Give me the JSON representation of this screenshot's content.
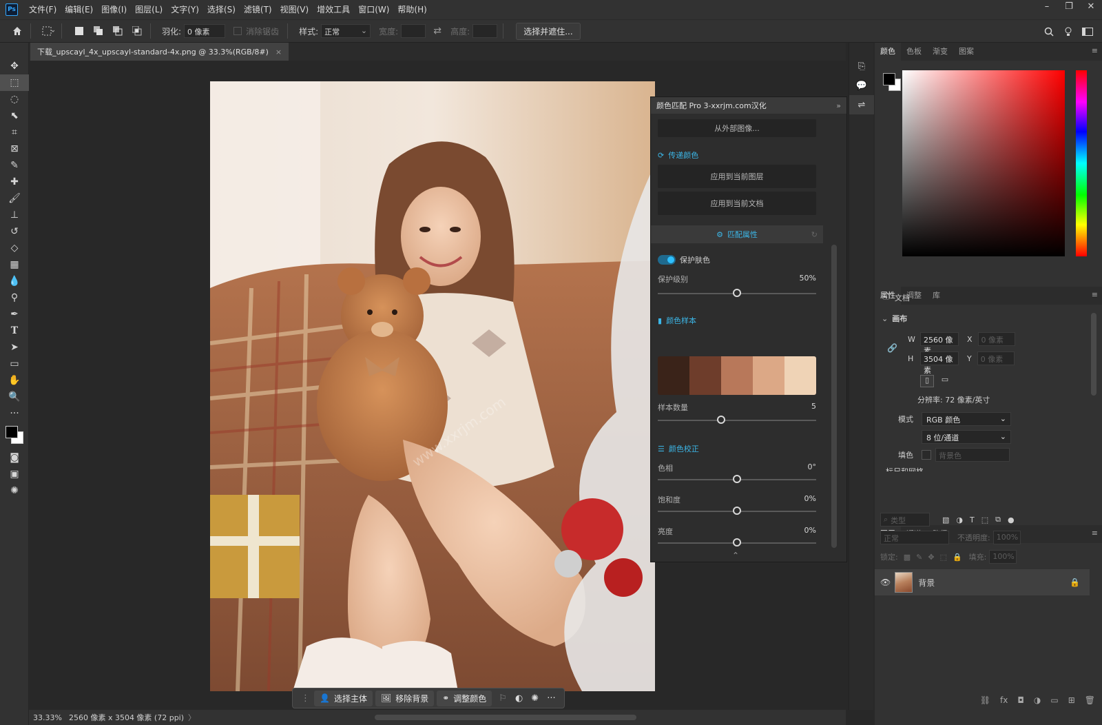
{
  "app": {
    "logo": "Ps",
    "menu": [
      "文件(F)",
      "编辑(E)",
      "图像(I)",
      "图层(L)",
      "文字(Y)",
      "选择(S)",
      "滤镜(T)",
      "视图(V)",
      "增效工具",
      "窗口(W)",
      "帮助(H)"
    ],
    "window_controls": [
      "–",
      "❐",
      "✕"
    ]
  },
  "options": {
    "feather_label": "羽化:",
    "feather_value": "0 像素",
    "antialias_label": "消除锯齿",
    "style_label": "样式:",
    "style_value": "正常",
    "width_label": "宽度:",
    "height_label": "高度:",
    "select_mask_button": "选择并遮住..."
  },
  "document": {
    "tab_title": "下载_upscayl_4x_upscayl-standard-4x.png @ 33.3%(RGB/8#)",
    "tab_close": "×"
  },
  "status": {
    "zoom": "33.33%",
    "info": "2560 像素 x 3504 像素 (72 ppi)",
    "arrow": "〉"
  },
  "context_bar": {
    "select_subject": "选择主体",
    "remove_bg": "移除背景",
    "adjust_color": "调整颜色",
    "more": "···"
  },
  "plugin": {
    "title": "颜色匹配 Pro 3-xxrjm.com汉化",
    "from_external": "从外部图像...",
    "transfer_section": "传递颜色",
    "apply_layer": "应用到当前图层",
    "apply_doc": "应用到当前文档",
    "match_props": "匹配属性",
    "protect_skin": "保护肤色",
    "protect_level_label": "保护级别",
    "protect_level_value": "50%",
    "protect_level": 0.5,
    "color_samples_section": "颜色样本",
    "swatches": [
      "#3a2319",
      "#6e3d2b",
      "#b8785a",
      "#dca886",
      "#efd3b6"
    ],
    "sample_count_label": "样本数量",
    "sample_count_value": "5",
    "sample_count": 0.4,
    "color_correction_section": "颜色校正",
    "hue_label": "色相",
    "hue_value": "0°",
    "saturation_label": "饱和度",
    "saturation_value": "0%",
    "brightness_label": "亮度",
    "brightness_value": "0%",
    "collapse": "⌃"
  },
  "right": {
    "color_tabs": [
      "颜色",
      "色板",
      "渐变",
      "图案"
    ],
    "props_tabs": [
      "属性",
      "调整",
      "库"
    ],
    "doc_label": "文档",
    "canvas_section": "画布",
    "w_label": "W",
    "w_value": "2560 像素",
    "h_label": "H",
    "h_value": "3504 像素",
    "x_label": "X",
    "x_placeholder": "0 像素",
    "y_label": "Y",
    "y_placeholder": "0 像素",
    "resolution": "分辨率: 72 像素/英寸",
    "mode_label": "模式",
    "mode_value": "RGB 颜色",
    "depth_value": "8 位/通道",
    "fill_label": "填色",
    "fill_value": "背景色",
    "cutoff_text": "标尺和网格",
    "layers_tabs": [
      "图层",
      "通道",
      "路径"
    ],
    "filter_placeholder": "类型",
    "blend_mode": "正常",
    "opacity_label": "不透明度:",
    "opacity_value": "100%",
    "lock_label": "锁定:",
    "fill2_label": "填充:",
    "fill2_value": "100%",
    "layer_name": "背景"
  },
  "colors": {
    "accent": "#3cb7e8",
    "panel_bg": "#323232"
  }
}
